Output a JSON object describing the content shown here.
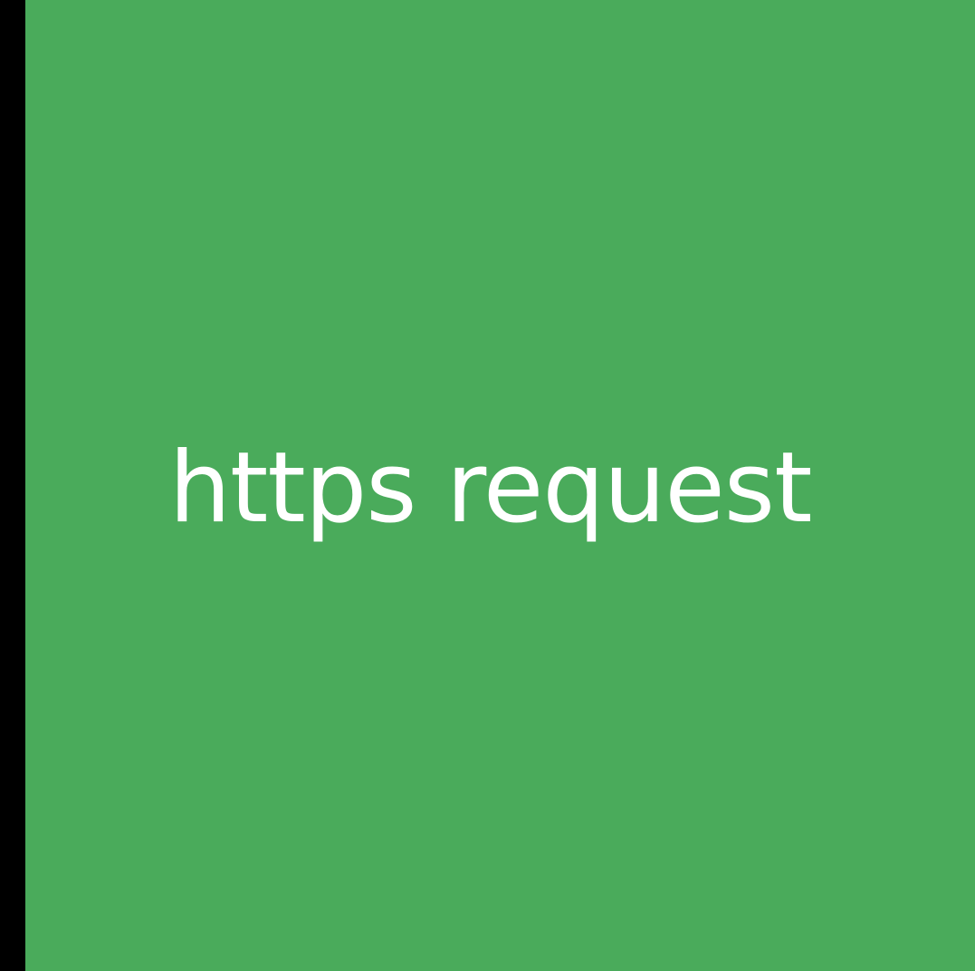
{
  "tile": {
    "label": "https request",
    "background_color": "#4aab5b",
    "text_color": "#ffffff"
  },
  "frame": {
    "border_color": "#000000"
  }
}
